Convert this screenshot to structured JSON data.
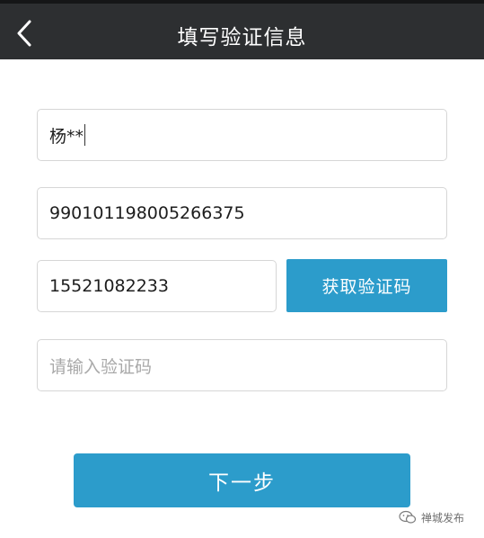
{
  "header": {
    "title": "填写验证信息",
    "back_icon": "chevron-left-icon"
  },
  "form": {
    "name_value": "杨**",
    "id_number_value": "990101198005266375",
    "phone_value": "15521082233",
    "get_code_label": "获取验证码",
    "code_placeholder": "请输入验证码",
    "next_label": "下一步"
  },
  "watermark": {
    "text": "禅城发布",
    "icon": "wechat-icon"
  },
  "colors": {
    "topbar": "#2d2f31",
    "accent": "#2c9ccb"
  }
}
